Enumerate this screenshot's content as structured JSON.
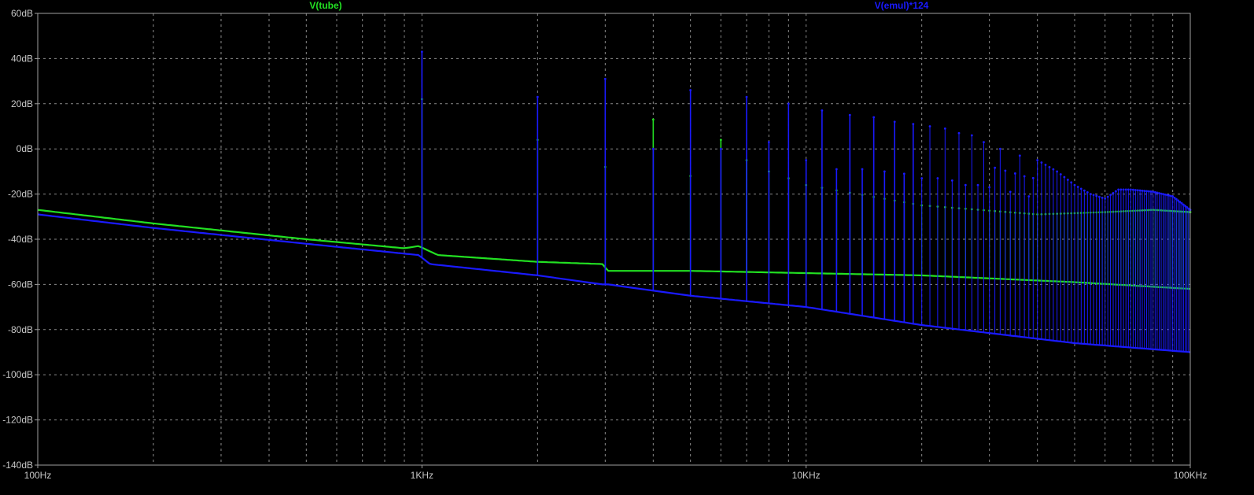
{
  "colors": {
    "background": "#000000",
    "plot_border": "#a0a0a0",
    "grid": "#8a8a8a",
    "tick_text": "#c8c8c8",
    "tube": "#22e022",
    "emul": "#1a1aff"
  },
  "chart_data": {
    "type": "line",
    "x_scale": "log",
    "xlim": [
      100,
      100000
    ],
    "ylim": [
      -140,
      60
    ],
    "grid": true,
    "x_ticks": [
      {
        "value": 100,
        "label": "100Hz"
      },
      {
        "value": 1000,
        "label": "1KHz"
      },
      {
        "value": 10000,
        "label": "10KHz"
      },
      {
        "value": 100000,
        "label": "100KHz"
      }
    ],
    "y_ticks": [
      {
        "value": 60,
        "label": "60dB"
      },
      {
        "value": 40,
        "label": "40dB"
      },
      {
        "value": 20,
        "label": "20dB"
      },
      {
        "value": 0,
        "label": "0dB"
      },
      {
        "value": -20,
        "label": "-20dB"
      },
      {
        "value": -40,
        "label": "-40dB"
      },
      {
        "value": -60,
        "label": "-60dB"
      },
      {
        "value": -80,
        "label": "-80dB"
      },
      {
        "value": -100,
        "label": "-100dB"
      },
      {
        "value": -120,
        "label": "-120dB"
      },
      {
        "value": -140,
        "label": "-140dB"
      }
    ],
    "legend_placement": "top",
    "series": [
      {
        "name": "V(tube)",
        "color": "#22e022",
        "noise_floor": [
          [
            100,
            -27
          ],
          [
            200,
            -33
          ],
          [
            500,
            -40
          ],
          [
            900,
            -44
          ],
          [
            980,
            -43
          ],
          [
            1100,
            -47
          ],
          [
            2000,
            -50
          ],
          [
            2950,
            -51
          ],
          [
            3050,
            -54
          ],
          [
            5000,
            -54
          ],
          [
            10000,
            -55
          ],
          [
            20000,
            -56
          ],
          [
            50000,
            -59
          ],
          [
            100000,
            -62
          ]
        ],
        "harmonic_peaks": [
          [
            1000,
            22
          ],
          [
            2000,
            4
          ],
          [
            3000,
            -8
          ],
          [
            4000,
            13
          ],
          [
            5000,
            -12
          ],
          [
            6000,
            4
          ],
          [
            7000,
            -5
          ],
          [
            8000,
            -10
          ],
          [
            9000,
            -13
          ],
          [
            10000,
            -16
          ],
          [
            20000,
            -25
          ],
          [
            40000,
            -29
          ],
          [
            60000,
            -28
          ],
          [
            80000,
            -27
          ],
          [
            100000,
            -28
          ]
        ]
      },
      {
        "name": "V(emul)*124",
        "color": "#1a1aff",
        "noise_floor": [
          [
            100,
            -29
          ],
          [
            200,
            -35
          ],
          [
            500,
            -42
          ],
          [
            980,
            -47
          ],
          [
            1050,
            -51
          ],
          [
            2000,
            -56
          ],
          [
            2950,
            -60
          ],
          [
            3050,
            -60
          ],
          [
            5000,
            -65
          ],
          [
            10000,
            -70
          ],
          [
            20000,
            -78
          ],
          [
            50000,
            -86
          ],
          [
            100000,
            -90
          ]
        ],
        "harmonic_peaks": [
          [
            1000,
            43
          ],
          [
            2000,
            23
          ],
          [
            3000,
            31
          ],
          [
            4000,
            0
          ],
          [
            5000,
            26
          ],
          [
            6000,
            0
          ],
          [
            7000,
            23
          ],
          [
            8000,
            3
          ],
          [
            9000,
            20
          ],
          [
            10000,
            -5
          ],
          [
            11000,
            17
          ],
          [
            12000,
            -9
          ],
          [
            13000,
            15
          ],
          [
            14000,
            -9
          ],
          [
            15000,
            14
          ],
          [
            16000,
            -10
          ],
          [
            17000,
            12
          ],
          [
            18000,
            -11
          ],
          [
            19000,
            11
          ],
          [
            20000,
            -13
          ],
          [
            21000,
            10
          ],
          [
            22000,
            -13
          ],
          [
            23000,
            9
          ],
          [
            24000,
            -14
          ],
          [
            25000,
            7
          ],
          [
            26000,
            -16
          ],
          [
            27000,
            6
          ],
          [
            28000,
            -16
          ],
          [
            29000,
            3
          ],
          [
            30000,
            -17
          ],
          [
            32000,
            0
          ],
          [
            34000,
            -19
          ],
          [
            36000,
            -3
          ],
          [
            38000,
            -21
          ],
          [
            40000,
            -5
          ],
          [
            45000,
            -10
          ],
          [
            50000,
            -16
          ],
          [
            55000,
            -20
          ],
          [
            60000,
            -22
          ],
          [
            65000,
            -18
          ],
          [
            70000,
            -18
          ],
          [
            80000,
            -19
          ],
          [
            90000,
            -21
          ],
          [
            100000,
            -27
          ]
        ]
      }
    ]
  }
}
